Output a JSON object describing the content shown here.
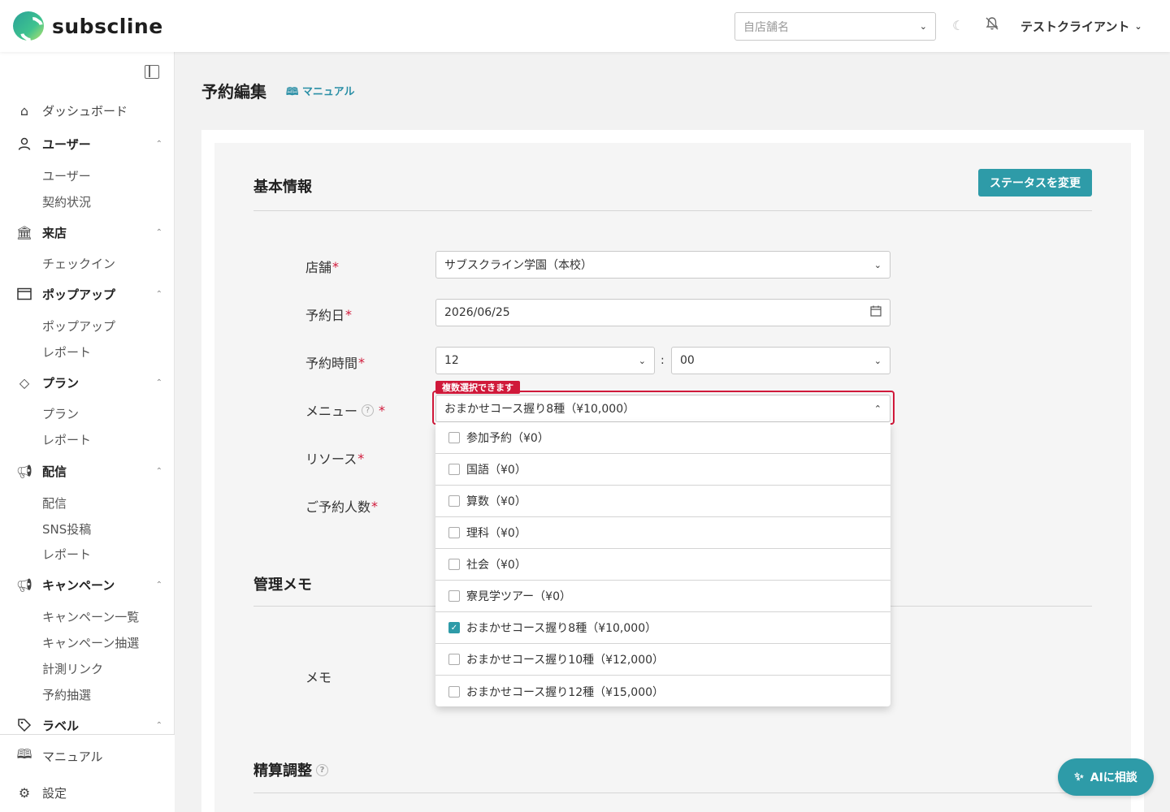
{
  "header": {
    "logo_text": "subscline",
    "store_placeholder": "自店舗名",
    "theme_icon": "moon-icon",
    "notification_icon": "bell-off-icon",
    "client_name": "テストクライアント"
  },
  "sidebar": {
    "dashboard": "ダッシュボード",
    "user_group": "ユーザー",
    "user_items": [
      "ユーザー",
      "契約状況"
    ],
    "visit_group": "来店",
    "visit_items": [
      "チェックイン"
    ],
    "popup_group": "ポップアップ",
    "popup_items": [
      "ポップアップ",
      "レポート"
    ],
    "plan_group": "プラン",
    "plan_items": [
      "プラン",
      "レポート"
    ],
    "delivery_group": "配信",
    "delivery_items": [
      "配信",
      "SNS投稿",
      "レポート"
    ],
    "campaign_group": "キャンペーン",
    "campaign_items": [
      "キャンペーン一覧",
      "キャンペーン抽選",
      "計測リンク",
      "予約抽選"
    ],
    "label_group": "ラベル",
    "manual": "マニュアル",
    "settings": "設定"
  },
  "page": {
    "title": "予約編集",
    "manual_link": "マニュアル"
  },
  "basic_info": {
    "title": "基本情報",
    "status_button": "ステータスを変更",
    "store_label": "店舗",
    "store_value": "サブスクライン学園（本校）",
    "date_label": "予約日",
    "date_value": "2026/06/25",
    "time_label": "予約時間",
    "hour_value": "12",
    "time_separator": ":",
    "minute_value": "00",
    "menu_label": "メニュー",
    "menu_badge": "複数選択できます",
    "menu_value": "おまかせコース握り8種（¥10,000）",
    "resource_label": "リソース",
    "people_label": "ご予約人数",
    "required_mark": "*",
    "help_mark": "?"
  },
  "menu_options": [
    {
      "label": "参加予約（¥0）",
      "checked": false
    },
    {
      "label": "国語（¥0）",
      "checked": false
    },
    {
      "label": "算数（¥0）",
      "checked": false
    },
    {
      "label": "理科（¥0）",
      "checked": false
    },
    {
      "label": "社会（¥0）",
      "checked": false
    },
    {
      "label": "寮見学ツアー（¥0）",
      "checked": false
    },
    {
      "label": "おまかせコース握り8種（¥10,000）",
      "checked": true
    },
    {
      "label": "おまかせコース握り10種（¥12,000）",
      "checked": false
    },
    {
      "label": "おまかせコース握り12種（¥15,000）",
      "checked": false
    }
  ],
  "memo": {
    "title": "管理メモ",
    "memo_label": "メモ"
  },
  "settlement": {
    "title": "精算調整"
  },
  "ai_button": "AIに相談",
  "colors": {
    "accent": "#2e9ba8",
    "required": "#d0193a"
  }
}
